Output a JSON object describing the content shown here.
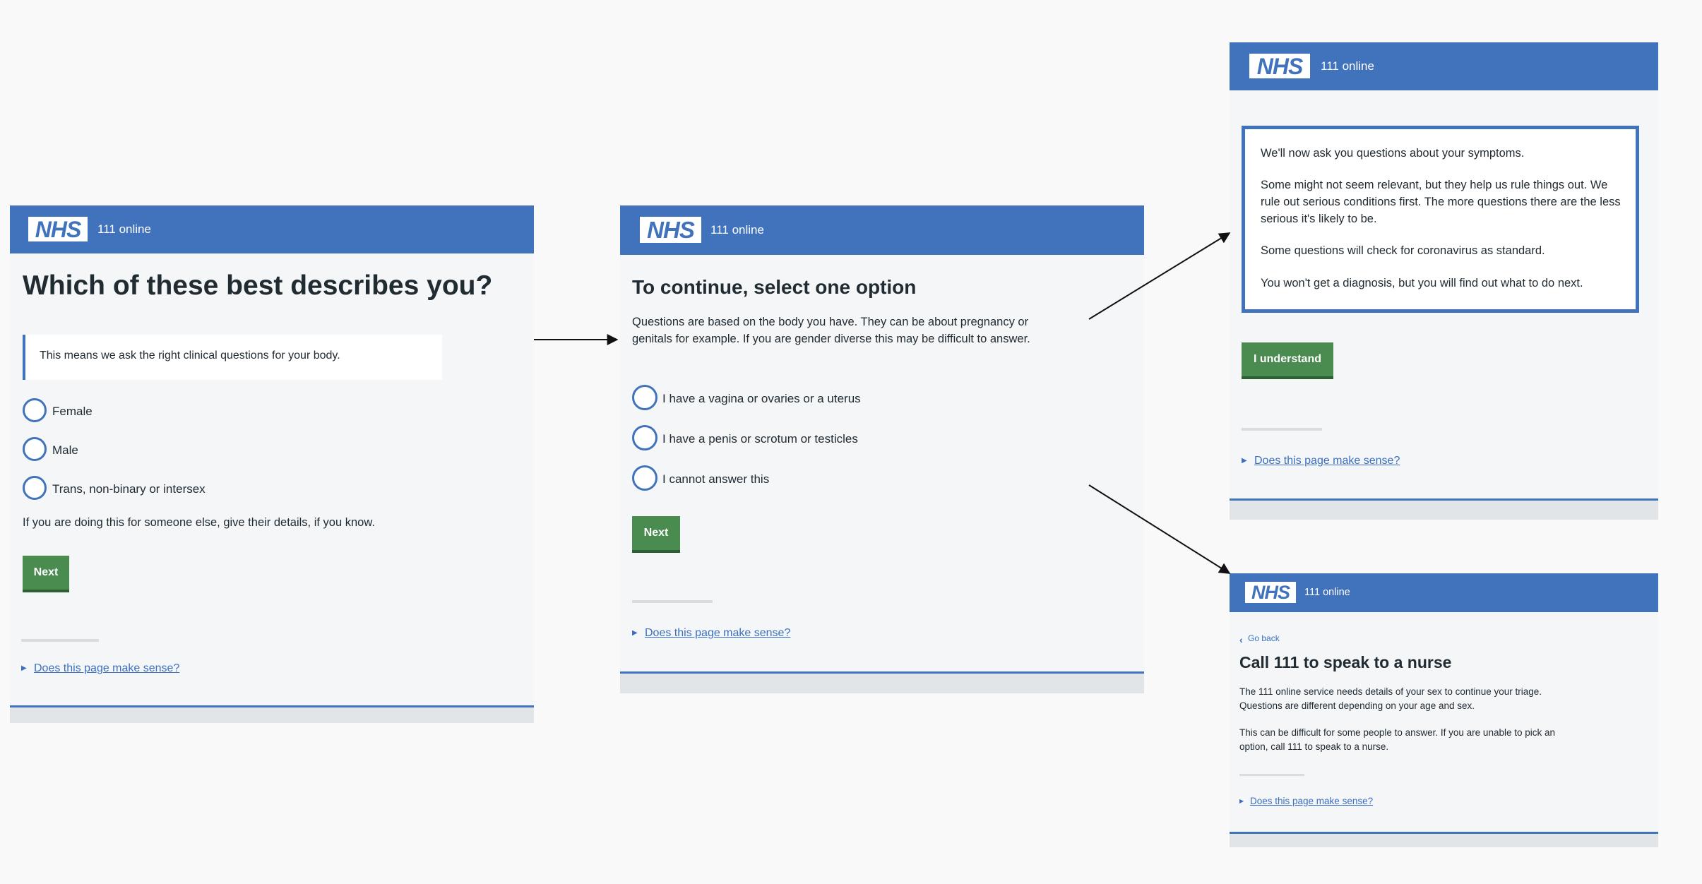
{
  "common": {
    "logo": "NHS",
    "service": "111 online",
    "feedback_link": "Does this page make sense?",
    "next_label": "Next",
    "link_icon": "triangle-right-icon",
    "back_icon": "chevron-left-icon"
  },
  "colors": {
    "header": "#4172bc",
    "button": "#4a8b50",
    "link": "#3b6fc0",
    "panel_bg": "#f4f6f8"
  },
  "screen1": {
    "title": "Which of these best describes you?",
    "hint": "This means we ask the right clinical questions for your body.",
    "options": [
      "Female",
      "Male",
      "Trans, non-binary or intersex"
    ],
    "note": "If you are doing this for someone else, give their details, if you know."
  },
  "screen2": {
    "title": "To continue, select one option",
    "body": "Questions are based on the body you have. They can be about pregnancy or genitals for example. If you are gender diverse this may be difficult to answer.",
    "options": [
      "I have a vagina or ovaries or a uterus",
      "I have a penis or scrotum or testicles",
      "I cannot answer this"
    ]
  },
  "screen3": {
    "paragraphs": [
      "We'll now ask you questions about your symptoms.",
      "Some might not seem relevant, but they help us rule things out. We rule out serious conditions first. The more questions there are the less serious it's likely to be.",
      "Some questions will check for coronavirus as standard.",
      "You won't get a diagnosis, but you will find out what to do next."
    ],
    "button": "I understand"
  },
  "screen4": {
    "back": "Go back",
    "title": "Call 111 to speak to a nurse",
    "paragraphs": [
      "The 111 online service needs details of your sex to continue your triage. Questions are different depending on your age and sex.",
      "This can be difficult for some people to answer. If you are unable to pick an option, call 111 to speak to a nurse."
    ]
  }
}
